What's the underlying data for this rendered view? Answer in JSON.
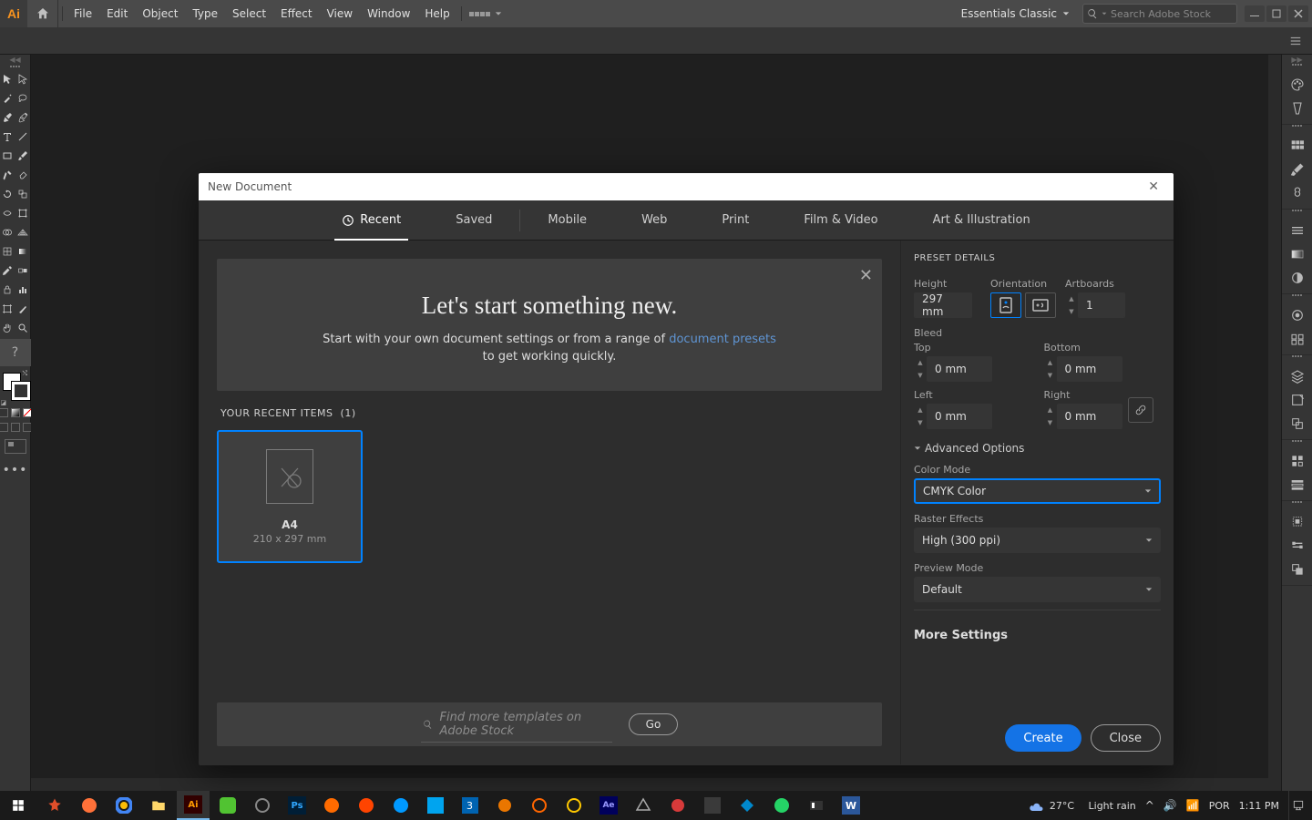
{
  "menubar": {
    "logo": "Ai",
    "items": [
      "File",
      "Edit",
      "Object",
      "Type",
      "Select",
      "Effect",
      "View",
      "Window",
      "Help"
    ],
    "workspace": "Essentials Classic",
    "search_placeholder": "Search Adobe Stock"
  },
  "dialog": {
    "title": "New Document",
    "tabs": [
      "Recent",
      "Saved",
      "Mobile",
      "Web",
      "Print",
      "Film & Video",
      "Art & Illustration"
    ],
    "welcome": {
      "title": "Let's start something new.",
      "line1": "Start with your own document settings or from a range of ",
      "link": "document presets",
      "line2": "to get working quickly."
    },
    "recents": {
      "header": "YOUR RECENT ITEMS",
      "count": "(1)",
      "items": [
        {
          "name": "A4",
          "dims": "210 x 297 mm"
        }
      ]
    },
    "stock_search_placeholder": "Find more templates on Adobe Stock",
    "go": "Go",
    "preset": {
      "title": "PRESET DETAILS",
      "height_label": "Height",
      "height_value": "297 mm",
      "orientation_label": "Orientation",
      "artboards_label": "Artboards",
      "artboards_value": "1",
      "bleed_label": "Bleed",
      "top": "Top",
      "bottom": "Bottom",
      "left": "Left",
      "right": "Right",
      "bleed_value": "0 mm",
      "adv": "Advanced Options",
      "color_mode_label": "Color Mode",
      "color_mode_value": "CMYK Color",
      "raster_label": "Raster Effects",
      "raster_value": "High (300 ppi)",
      "preview_label": "Preview Mode",
      "preview_value": "Default",
      "more": "More Settings"
    },
    "create": "Create",
    "close": "Close"
  },
  "taskbar": {
    "weather_temp": "27°C",
    "weather_text": "Light rain",
    "lang": "POR",
    "time": "1:11 PM"
  }
}
